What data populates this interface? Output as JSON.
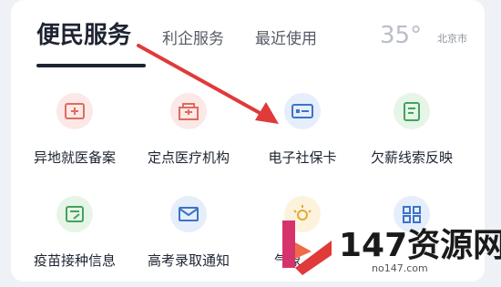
{
  "tabs": {
    "active": "便民服务",
    "second": "利企服务",
    "third": "最近使用"
  },
  "weather": {
    "temp": "35°",
    "city": "北京市"
  },
  "services": [
    {
      "label": "异地就医备案",
      "icon": "hospital-record-icon",
      "color": "#e06b5e"
    },
    {
      "label": "定点医疗机构",
      "icon": "hospital-building-icon",
      "color": "#e06b5e"
    },
    {
      "label": "电子社保卡",
      "icon": "id-card-icon",
      "color": "#3b73c9"
    },
    {
      "label": "欠薪线索反映",
      "icon": "wage-report-icon",
      "color": "#43a35a"
    },
    {
      "label": "疫苗接种信息",
      "icon": "vaccine-icon",
      "color": "#43a35a"
    },
    {
      "label": "高考录取通知",
      "icon": "mail-icon",
      "color": "#3b73c9"
    },
    {
      "label": "气象",
      "icon": "sun-icon",
      "color": "#e2a93a"
    },
    {
      "label": "",
      "icon": "apps-grid-icon",
      "color": "#3b73c9"
    }
  ],
  "watermark": {
    "brand": "147资源网",
    "url": "no147.com"
  },
  "colors": {
    "accent_red": "#e03a3a",
    "text_dark": "#1f2433"
  }
}
